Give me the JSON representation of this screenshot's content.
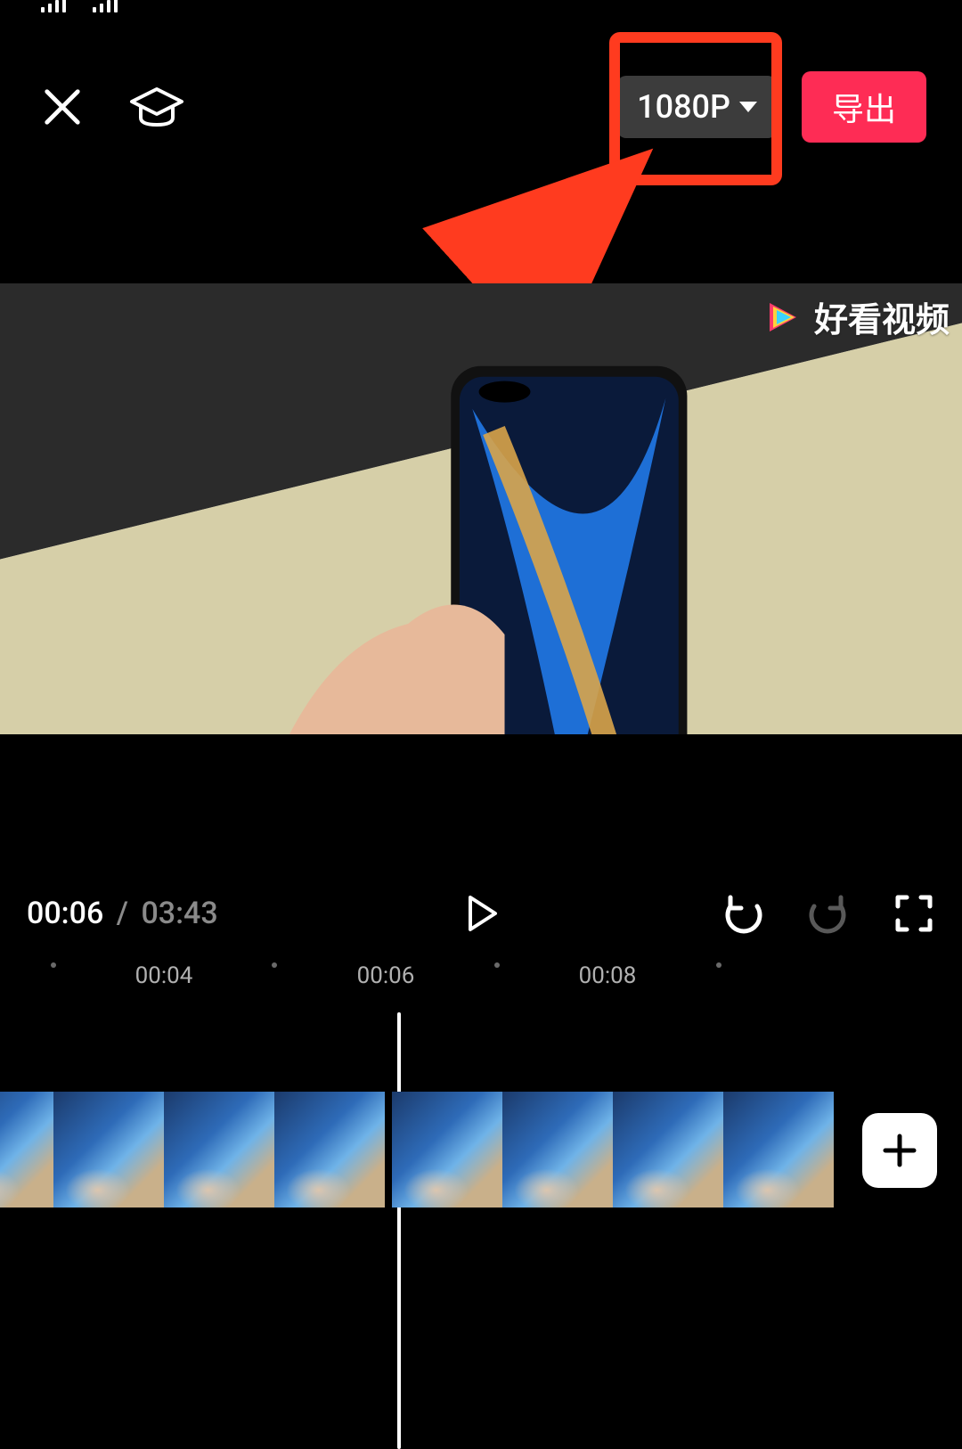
{
  "status": {
    "time": ""
  },
  "topbar": {
    "resolution_label": "1080P",
    "export_label": "导出"
  },
  "watermark": {
    "text": "好看视频"
  },
  "transport": {
    "current": "00:06",
    "separator": "/",
    "total": "03:43"
  },
  "ruler": {
    "marks": [
      "00:04",
      "00:06",
      "00:08"
    ]
  },
  "icons": {
    "close": "close-icon",
    "tutorial": "graduation-cap-icon",
    "play": "play-icon",
    "undo": "undo-icon",
    "redo": "redo-icon",
    "fullscreen": "fullscreen-icon",
    "add": "plus-icon"
  },
  "annotation": {
    "highlight_target": "export-button"
  }
}
